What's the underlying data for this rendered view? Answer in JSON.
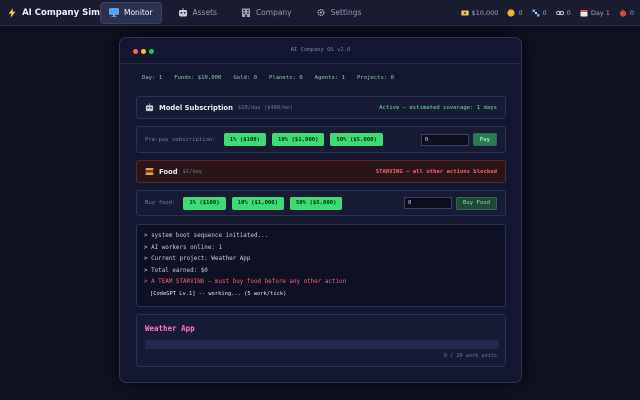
{
  "app": {
    "title": "AI Company Sim",
    "nav": [
      {
        "label": "Monitor",
        "active": true,
        "icon": "monitor-icon"
      },
      {
        "label": "Assets",
        "active": false,
        "icon": "robot-icon"
      },
      {
        "label": "Company",
        "active": false,
        "icon": "building-icon"
      },
      {
        "label": "Settings",
        "active": false,
        "icon": "gear-icon"
      }
    ],
    "stats": [
      {
        "icon": "money-icon",
        "value": "$10,000"
      },
      {
        "icon": "coin-icon",
        "value": "0"
      },
      {
        "icon": "satellite-icon",
        "value": "0"
      },
      {
        "icon": "link-icon",
        "value": "0"
      },
      {
        "icon": "calendar-icon",
        "value": "Day 1"
      },
      {
        "icon": "apple-icon",
        "value": "0"
      }
    ]
  },
  "window": {
    "title": "AI Company OS v2.0",
    "status": [
      "Day: 1",
      "Funds: $10,000",
      "Gold: 0",
      "Planets: 0",
      "Agents: 1",
      "Projects: 0"
    ]
  },
  "model_subscription": {
    "title": "Model Subscription",
    "rate": "$10/day ($400/mo)",
    "status": "Active — estimated coverage: 1 days",
    "prepay_label": "Pre-pay subscription:",
    "buttons": [
      "1% ($100)",
      "10% ($1,000)",
      "50% ($5,000)"
    ],
    "input_value": "0",
    "submit_label": "Pay"
  },
  "food": {
    "title": "Food",
    "rate": "$1/day",
    "status": "STARVING — all other actions blocked",
    "buy_label": "Buy food:",
    "buttons": [
      "1% ($100)",
      "10% ($1,000)",
      "50% ($5,000)"
    ],
    "input_value": "0",
    "submit_label": "Buy Food"
  },
  "log": [
    "> system boot sequence initiated...",
    "> AI workers online: 1",
    "> Current project: Weather App",
    "> Total earned: $0",
    "> A TEAM STARVING — must buy food before any other action",
    "[CodeGPT Lv.1] -- working... (5 work/tick)"
  ],
  "project": {
    "title": "Weather App",
    "progress": 0,
    "units_text": "0 / 20 work units"
  },
  "colors": {
    "accent_green": "#3bdc73",
    "danger_red": "#ff5d6c",
    "project_pink": "#ff78c8",
    "background": "#0f1120"
  }
}
